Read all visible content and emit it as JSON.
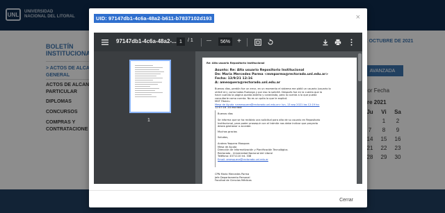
{
  "background": {
    "logo_mark": "UNL",
    "logo_line1": "UNIVERSIDAD",
    "logo_line2": "NACIONAL DEL LITORAL",
    "bulletin_title_1": "BOLETÍN",
    "bulletin_title_2": "INSTITUCIONAL",
    "nav_active_1": "> ACTOS DE ALCA",
    "nav_active_2": "GENERAL",
    "nav_items": [
      "ACTOS DE ALCAN",
      "PARTICULAR",
      "DIPLOMAS",
      "CONCURSOS",
      "COMPRAS Y",
      "CONTRATACIONE"
    ],
    "date_text": "E OCTUBRE DE 2021",
    "advanced_button": "AVANZADA",
    "sort_label": "por Fecha",
    "calendar_month": "re 2021",
    "calendar_headers": [
      "Ju",
      "Vi",
      "Sa"
    ],
    "calendar_days": [
      "",
      "1",
      "2",
      "7",
      "8",
      "9",
      "14",
      "15",
      "16",
      "21",
      "22",
      "23",
      "28",
      "29",
      "30"
    ]
  },
  "modal": {
    "title": "UID: 97147db1-4c6a-48a2-b611-b7837102d193",
    "close_icon": "×",
    "close_button": "Cerrar",
    "colors": {
      "title_highlight": "#2f6fce",
      "toolbar": "#323639",
      "viewer_bg": "#525659"
    }
  },
  "pdf_toolbar": {
    "menu_icon": "hamburger-icon",
    "filename": "97147db1-4c6a-48a2-...",
    "page_current": "1",
    "page_total": "/ 1",
    "zoom_minus": "—",
    "zoom_value": "56%",
    "zoom_plus": "+",
    "fit_icon": "fit-page-icon",
    "rotate_icon": "rotate-icon",
    "download_icon": "download-icon",
    "print_icon": "print-icon",
    "more_icon": "more-vert-icon"
  },
  "thumbnail": {
    "page_number": "1"
  },
  "document": {
    "header_subject": "Re: Alta usuario Repositorio Institucional",
    "asunto": "Asunto: Re: Alta usuario Repositorio Institucional",
    "de": "De: Maria Mercedes Parma <mmparma@rectorado.unl.edu.ar>",
    "fecha": "Fecha: 13/9/21 12:16",
    "para": "A: amesquera@rectorado.unl.edu.ar",
    "body_lines": [
      "Buenos días, perdón fue un error, en un momento el sistema me pidió un usuario (usuario lo",
      "utilicé en), como todos Ruesnga y por eso la solicité. Después fue en la cuenta que la",
      "hace cuando la página queda abierta y conectada, pero la cuenta a lo que pueda",
      "consultarle como cuenta. No es un quita lo que le explicó.",
      "MGT Fitxiciu",
      "Mesa de Ayuda <amesquera@rectorado.unl.edu.ar> lun, 13 sep 2021 las 12:19 hs:",
      "12:07:16 -03 escribió:"
    ],
    "quote_lines": [
      "Buenos días",
      "",
      "Se informa que se ha recibido una solicitud para alta de su usuario en Repositorio",
      "Institucional, para poder prosequir con el trámite nos debe indicar que proyecto",
      "desea gestionar o acceder.",
      "",
      "Muchas gracias",
      "",
      "Saludos,",
      "",
      "Andrea Yaquera Masquea",
      "Mesa de Ayuda",
      "Dirección de Informatización y Planificación Tecnológica.",
      "Rectorado - Universidad Nacional del Litoral",
      "Teléfono: 4571110 Int. 338",
      "Email: amesquera@rectorado.unl.edu.ar"
    ],
    "signature_lines": [
      "CPN María Mercedes Parma",
      "Jefe Departamento Personal",
      "Facultad de Ciencias Médicas"
    ]
  }
}
